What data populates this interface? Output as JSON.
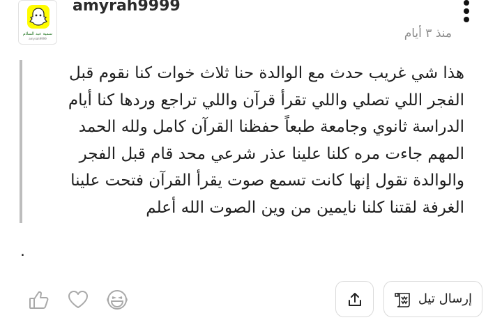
{
  "post": {
    "username": "amyrah9999",
    "time_ago": "منذ ٣ أيام",
    "avatar_caption": "سمية عبد السلام",
    "avatar_subcaption": "amyrah9999",
    "body": "هذا شي غريب حدث مع الوالدة حنا ثلاث خوات كنا نقوم قبل\nالفجر اللي تصلي واللي تقرأ قرآن واللي تراجع وردها كنا أيام\nالدراسة ثانوي وجامعة طبعاً حفظنا القرآن كامل ولله الحمد\nالمهم جاءت مره كلنا علينا عذر شرعي محد قام قبل الفجر\nوالوالدة تقول إنها كانت تسمع صوت يقرأ القرآن فتحت علينا\nالغرفة لقتنا كلنا نايمين من وين الصوت الله أعلم",
    "trailing_text": "."
  },
  "actions": {
    "send_tale_label": "إرسال تيل",
    "icons": [
      "like-icon",
      "heart-icon",
      "laugh-icon",
      "share-icon",
      "scroll-icon",
      "more-icon"
    ]
  },
  "colors": {
    "quote_border": "#bdbdbd",
    "muted_text": "#8a8a8a",
    "button_border": "#dadada",
    "icon_gray": "#a9a9a9",
    "avatar_yellow": "#fffc00"
  }
}
